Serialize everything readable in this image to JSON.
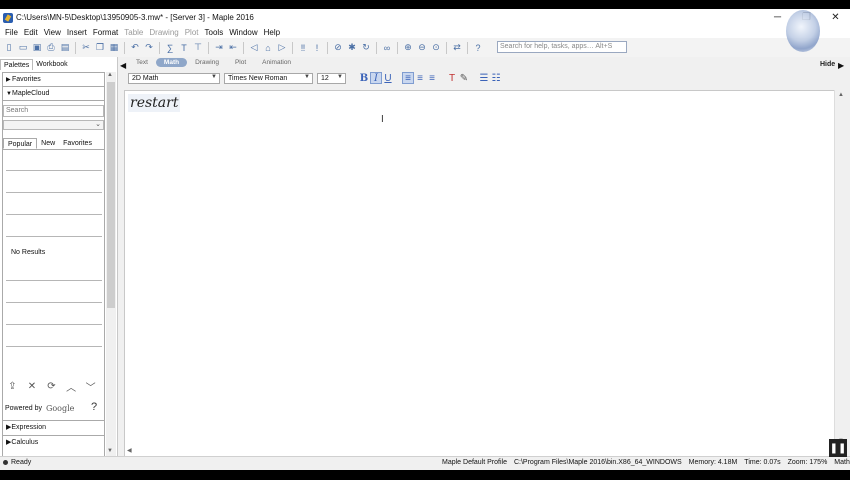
{
  "window": {
    "title": "C:\\Users\\MN-5\\Desktop\\13950905-3.mw* - [Server 3] - Maple 2016",
    "minimize": "─",
    "restore": "❐",
    "close": "✕"
  },
  "menu": [
    {
      "label": "File",
      "disabled": false
    },
    {
      "label": "Edit",
      "disabled": false
    },
    {
      "label": "View",
      "disabled": false
    },
    {
      "label": "Insert",
      "disabled": false
    },
    {
      "label": "Format",
      "disabled": false
    },
    {
      "label": "Table",
      "disabled": true
    },
    {
      "label": "Drawing",
      "disabled": true
    },
    {
      "label": "Plot",
      "disabled": true
    },
    {
      "label": "Tools",
      "disabled": false
    },
    {
      "label": "Window",
      "disabled": false
    },
    {
      "label": "Help",
      "disabled": false
    }
  ],
  "toolbar": {
    "search_placeholder": "Search for help, tasks, apps… Alt+S",
    "hide_label": "Hide"
  },
  "palette_panel": {
    "tabs": [
      "Palettes",
      "Workbook"
    ],
    "active_tab": "Palettes",
    "favorites_label": "Favorites",
    "maplecloud_label": "MapleCloud",
    "search_placeholder": "Search",
    "cloud_tabs": [
      "Popular",
      "New",
      "Favorites"
    ],
    "active_cloud_tab": "Popular",
    "no_results": "No Results",
    "powered_by": "Powered by",
    "google": "Google",
    "help": "?",
    "expression_label": "Expression",
    "calculus_label": "Calculus"
  },
  "mode_bar": {
    "modes": [
      "Text",
      "Math",
      "Drawing",
      "Plot",
      "Animation"
    ],
    "active": "Math"
  },
  "format_bar": {
    "input_mode": "2D Math",
    "font": "Times New Roman",
    "size": "12",
    "bold": "B",
    "italic": "I",
    "underline": "U"
  },
  "document": {
    "input": "restart"
  },
  "status": {
    "ready": "Ready",
    "profile": "Maple Default Profile",
    "path": "C:\\Program Files\\Maple 2016\\bin.X86_64_WINDOWS",
    "memory": "Memory: 4.18M",
    "time": "Time: 0.07s",
    "zoom": "Zoom: 175%",
    "mode": "Math"
  }
}
